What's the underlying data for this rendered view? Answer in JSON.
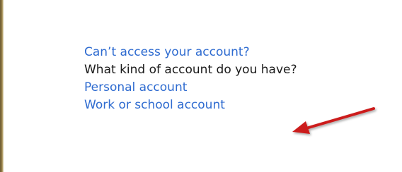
{
  "account_help": {
    "cant_access_link": "Can’t access your account?",
    "account_type_question": "What kind of account do you have?",
    "personal_account_link": "Personal account",
    "work_school_account_link": "Work or school account"
  },
  "colors": {
    "link": "#2e6bd0",
    "text": "#1a1a1a",
    "arrow": "#cc1f1f"
  },
  "annotation": {
    "icon": "red-arrow-icon"
  }
}
